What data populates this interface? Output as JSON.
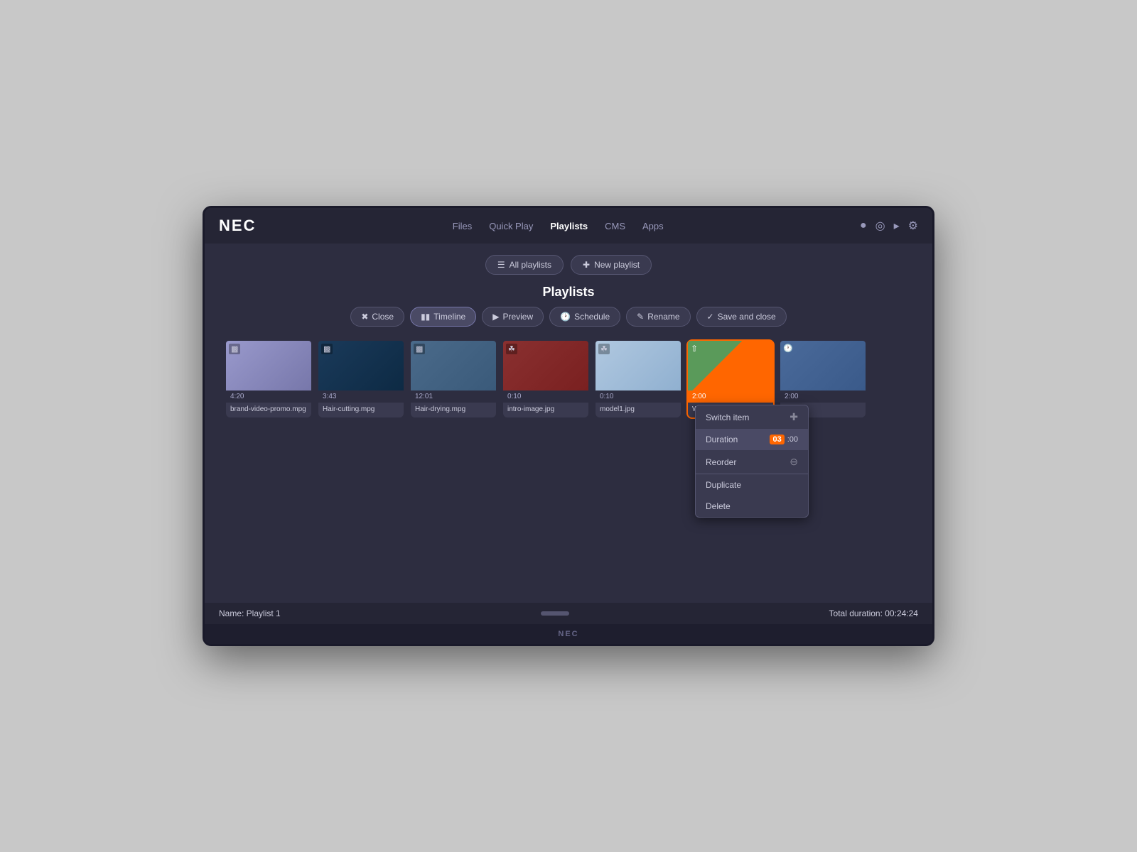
{
  "brand": "NEC",
  "nav": {
    "links": [
      {
        "label": "Files",
        "active": false
      },
      {
        "label": "Quick Play",
        "active": false
      },
      {
        "label": "Playlists",
        "active": true
      },
      {
        "label": "CMS",
        "active": false
      },
      {
        "label": "Apps",
        "active": false
      }
    ],
    "icons": [
      "user-icon",
      "globe-icon",
      "wifi-icon",
      "gear-icon"
    ]
  },
  "page_title": "Playlists",
  "header_buttons": {
    "all_playlists": "All playlists",
    "new_playlist": "New playlist"
  },
  "toolbar": {
    "close": "Close",
    "timeline": "Timeline",
    "preview": "Preview",
    "schedule": "Schedule",
    "rename": "Rename",
    "save_close": "Save and close"
  },
  "media_items": [
    {
      "name": "brand-video-promo.mpg",
      "duration": "4:20",
      "thumb": "purple",
      "icon": "video",
      "selected": false
    },
    {
      "name": "Hair-cutting.mpg",
      "duration": "3:43",
      "thumb": "darkblue",
      "icon": "video",
      "selected": false
    },
    {
      "name": "Hair-drying.mpg",
      "duration": "12:01",
      "thumb": "steelblue",
      "icon": "video",
      "selected": false
    },
    {
      "name": "intro-image.jpg",
      "duration": "0:10",
      "thumb": "red",
      "icon": "image",
      "selected": false
    },
    {
      "name": "model1.jpg",
      "duration": "0:10",
      "thumb": "lightblue",
      "icon": "image",
      "selected": false
    },
    {
      "name": "Weather",
      "duration": "2:00",
      "thumb": "weather",
      "icon": "weather",
      "selected": true
    },
    {
      "name": "Clock",
      "duration": "2:00",
      "thumb": "clock",
      "icon": "clock",
      "selected": false
    }
  ],
  "context_menu": {
    "items": [
      {
        "label": "Switch item",
        "action": "switch",
        "right_icon": "plus"
      },
      {
        "label": "Duration",
        "action": "duration",
        "right_content": "03:00"
      },
      {
        "label": "Reorder",
        "action": "reorder",
        "right_icon": "minus"
      },
      {
        "label": "Duplicate",
        "action": "duplicate"
      },
      {
        "label": "Delete",
        "action": "delete"
      }
    ]
  },
  "bottom": {
    "playlist_name": "Name: Playlist 1",
    "total_duration": "Total duration: 00:24:24"
  },
  "footer_brand": "NEC"
}
